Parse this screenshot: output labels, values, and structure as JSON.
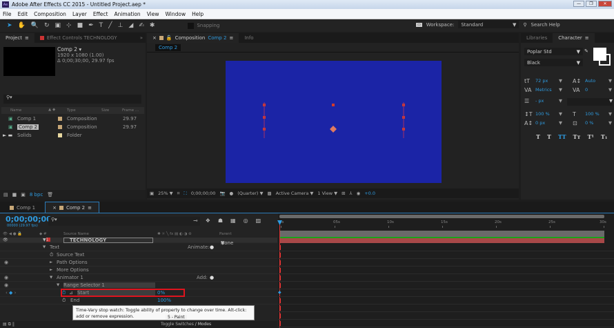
{
  "window": {
    "title": "Adobe After Effects CC 2015 - Untitled Project.aep *",
    "app_icon": "Ae"
  },
  "menu": [
    "File",
    "Edit",
    "Composition",
    "Layer",
    "Effect",
    "Animation",
    "View",
    "Window",
    "Help"
  ],
  "toolbar": {
    "tools": [
      "selection-tool",
      "hand-tool",
      "zoom-tool",
      "rotation-tool",
      "camera-tool",
      "pan-behind-tool",
      "rectangle-tool",
      "pen-tool",
      "type-tool",
      "brush-tool",
      "clone-stamp-tool",
      "eraser-tool",
      "roto-brush-tool",
      "puppet-pin-tool"
    ],
    "snapping": "Snapping",
    "workspace_label": "Workspace:",
    "workspace": "Standard",
    "search": "Search Help"
  },
  "project": {
    "tab": "Project",
    "effect_tab": "Effect Controls TECHNOLOGY",
    "selected": {
      "name": "Comp 2 ▾",
      "dims": "1920 x 1080 (1.00)",
      "duration": "Δ 0;00;30;00, 29.97 fps"
    },
    "columns": [
      "Name",
      "Type",
      "Size",
      "Frame ..."
    ],
    "items": [
      {
        "name": "Comp 1",
        "type": "Composition",
        "frame": "29.97"
      },
      {
        "name": "Comp 2",
        "type": "Composition",
        "frame": "29.97"
      },
      {
        "name": "Solids",
        "type": "Folder",
        "frame": ""
      }
    ],
    "bpc": "8 bpc"
  },
  "composition": {
    "tab_prefix": "Composition",
    "tab_name": "Comp 2",
    "info_tab": "Info",
    "breadcrumb": "Comp 2",
    "background": "#1b24a6",
    "footer": {
      "zoom": "25%",
      "timecode": "0;00;00;00",
      "resolution": "(Quarter)",
      "camera": "Active Camera",
      "view": "1 View",
      "exposure": "+0.0"
    }
  },
  "character": {
    "libraries_tab": "Libraries",
    "tab": "Character",
    "font": "Poplar Std",
    "style": "Black",
    "size": "72 px",
    "leading": "Auto",
    "kerning": "Metrics",
    "tracking": "0",
    "stroke": "- px",
    "vscale": "100 %",
    "hscale": "100 %",
    "baseline": "0 px",
    "tsume": "0 %",
    "styles": [
      "T",
      "T",
      "TT",
      "Tт",
      "T¹",
      "T₁"
    ]
  },
  "timeline": {
    "tabs": [
      "Comp 1",
      "Comp 2"
    ],
    "timecode": "0;00;00;00",
    "fps": "00000 (29.97 fps)",
    "headers": {
      "source": "Source Name",
      "parent": "Parent"
    },
    "layer": {
      "num": "1",
      "name": "TECHNOLOGY",
      "parent": "None"
    },
    "ruler": [
      "0s",
      "05s",
      "10s",
      "15s",
      "20s",
      "25s",
      "30s"
    ],
    "properties": [
      {
        "label": "Text",
        "indent": 1,
        "arrow": "▼",
        "extra": "Animate:"
      },
      {
        "label": "Source Text",
        "indent": 2,
        "arrow": ""
      },
      {
        "label": "Path Options",
        "indent": 2,
        "arrow": "►"
      },
      {
        "label": "More Options",
        "indent": 2,
        "arrow": "►"
      },
      {
        "label": "Animator 1",
        "indent": 2,
        "arrow": "▼",
        "extra": "Add:"
      },
      {
        "label": "Range Selector 1",
        "indent": 3,
        "arrow": "▼"
      },
      {
        "label": "Start",
        "indent": 4,
        "value": "0%",
        "highlight": true
      },
      {
        "label": "End",
        "indent": 4,
        "value": "100%"
      }
    ],
    "tooltip": "Time-Vary stop watch: Toggle ability of property to change over time. Alt-click: add or remove expression.",
    "footer": {
      "toggle_label": "Toggle Switches / Modes",
      "paint_tip": "5 - Paint",
      "modes": "/ Modes"
    },
    "highlight_color": "#e0141e"
  }
}
